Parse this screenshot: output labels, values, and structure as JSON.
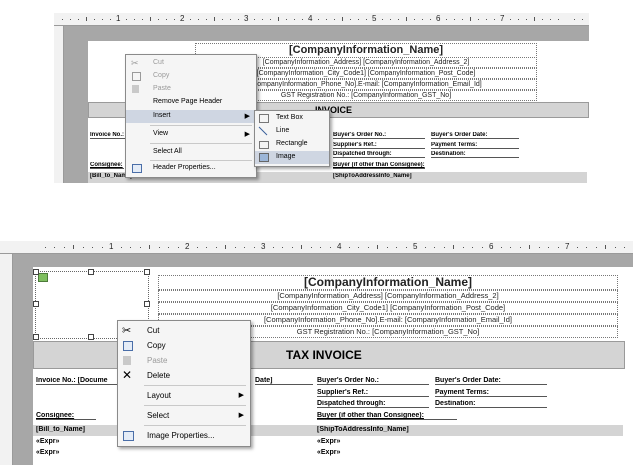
{
  "ruler": {
    "numbers": [
      "1",
      "2",
      "3",
      "4",
      "5",
      "6",
      "7"
    ]
  },
  "report": {
    "company_name": "[CompanyInformation_Name]",
    "address": "[CompanyInformation_Address] [CompanyInformation_Address_2]",
    "city": "[CompanyInformation_City_Code1] [CompanyInformation_Post_Code]",
    "phone": "[CompanyInformation_Phone_No].E-mail: [CompanyInformation_Email_Id]",
    "gst": "GST Registration No.: [CompanyInformation_GST_No]",
    "title": "TAX INVOICE",
    "invoice_no": "Invoice No.: [Docume",
    "date": "Date]",
    "buyers_order_no": "Buyer's Order No.:",
    "buyers_order_date": "Buyer's Order Date:",
    "suppliers_ref": "Supplier's Ref.:",
    "payment_terms": "Payment Terms:",
    "dispatched_through": "Dispatched through:",
    "destination": "Destination:",
    "consignee": "Consignee:",
    "buyer": "Buyer (if other than Consignee):",
    "bill_to": "[Bill_to_Name]",
    "ship_to": "[ShipToAddressInfo_Name]",
    "expr": "«Expr»"
  },
  "top_panel": {
    "fields": {
      "address": "[CompanyInformation_Address] [CompanyInformation_Address_2]",
      "city": "[CompanyInformation_City_Code1] [CompanyInformation_Post_Code]",
      "phone": "[CompanyInformation_Phone_No].E-mail: [CompanyInformation_Email_Id]",
      "gst": "GST Registration No.: [CompanyInformation_GST_No]",
      "title_partial": "INVOICE",
      "invoice_no": "Invoice No.:",
      "consignee": "Consignee:",
      "bill_to": "[Bill_to_Name]"
    },
    "context_menu": {
      "cut": "Cut",
      "copy": "Copy",
      "paste": "Paste",
      "remove_page_header": "Remove Page Header",
      "insert": "Insert",
      "view": "View",
      "select_all": "Select All",
      "header_properties": "Header Properties..."
    },
    "insert_submenu": {
      "text_box": "Text Box",
      "line": "Line",
      "rectangle": "Rectangle",
      "image": "Image"
    }
  },
  "bottom_panel": {
    "context_menu": {
      "cut": "Cut",
      "copy": "Copy",
      "paste": "Paste",
      "delete": "Delete",
      "layout": "Layout",
      "select": "Select",
      "image_properties": "Image Properties..."
    }
  }
}
